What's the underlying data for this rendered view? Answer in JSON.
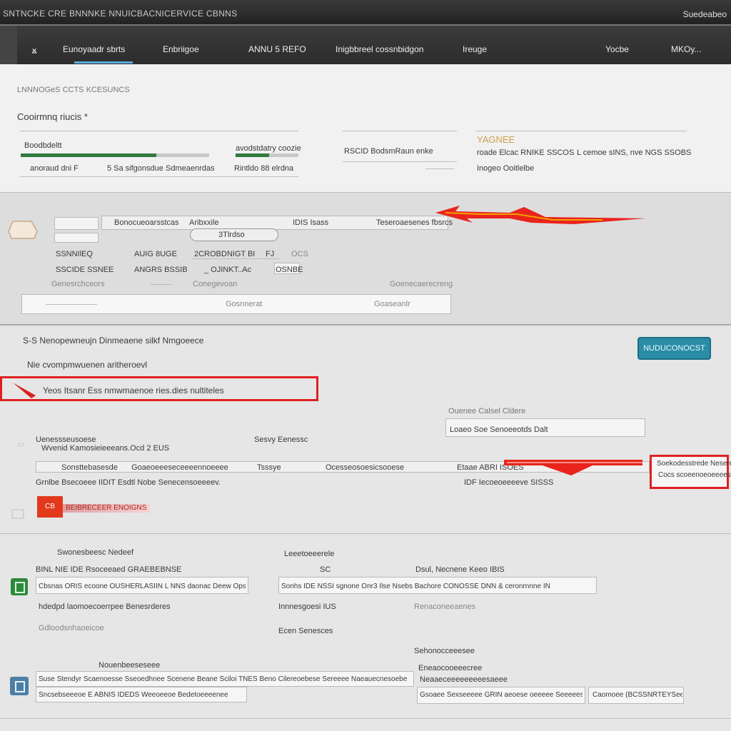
{
  "window": {
    "title": "SNTNCKE CRE BNNNKE NNUICBACNICERVICE CBNNS",
    "right_label": "Suedeabeo"
  },
  "nav": {
    "items": [
      {
        "label": "Eunoyaadr sbrts",
        "active": true
      },
      {
        "label": "Enbriigoe"
      },
      {
        "label": "ANNU 5 REFO"
      },
      {
        "label": "Inigbbreel cossnbidgon"
      },
      {
        "label": "Ireuge"
      },
      {
        "label": "Yocbe"
      },
      {
        "label": "MKOy..."
      }
    ]
  },
  "summary": {
    "breadcrumb": "LNNNOGeS CCTS  KCESUNCS",
    "heading": "Cooirmnq riucis *",
    "card1": {
      "label": "Boodbdeltt",
      "progress_a": 0.22,
      "progress_b": 0.72,
      "foot_left": "anoraud dni F",
      "foot_mid": "5 Sa sifgonsdue",
      "foot_right": "Sdmeaenrdas"
    },
    "card2": {
      "label": "avodstdatry coozie",
      "progress": 0.53,
      "foot": "Rintldo 88 elrdna"
    },
    "card3": {
      "label": "RSCID BodsmRaun enke"
    },
    "card4": {
      "title": "YAGNEE",
      "line1": "roade Elcac RNIKE SSCOS",
      "line2": "L cemoe sINS, nve NGS SSOBS",
      "line3": "Inogeo Ooitlelbe"
    }
  },
  "table": {
    "head_col1": "Bonocueoarsstcas",
    "head_col2": "Aribxxile",
    "head_col3": "IDIS Isass",
    "head_col4": "Teseroaesenes fbsrcs",
    "pill": "3Tlrdso",
    "row1": {
      "c1": "SSNNIlEQ",
      "c2": "AUIG 8UGE",
      "c3": "2CROBDNIGT BI",
      "c4": "FJ",
      "c5": "OCS"
    },
    "row2": {
      "c1": "SSCIDE SSNEE",
      "c2": "ANGRS BSSIB",
      "c3": "_ OJINKT..Ac",
      "c4": "OSNBE"
    },
    "row3": {
      "c1": "Genesrchceors",
      "c2": "Conegevoan",
      "c3": "Goenecaerecreng"
    },
    "row4": {
      "c1": "Gosnnerat",
      "c2": "Goaseanlr"
    }
  },
  "details": {
    "title": "S-S Nenopewneujn Dinmeaene silkf Nmgoeece",
    "subtitle": "Nie cvompmwuenen aritheroevl",
    "highlight": "Yeos Itsanr Ess   nmwmaenoe ries.dies nultiteles",
    "button": "NUDUCONOCST",
    "right_label1": "Ouenee Calsel Cldere",
    "right_label2": "Loaeo Soe Senoeeotds Dalt",
    "left_label1": "Uenessseusoese",
    "left_label2": "Wvenid Kamosieieeeans.Ocd 2 EUS",
    "mid_label": "Sesvy Eenessc",
    "row_cells": [
      "Sonsttebasesde",
      "Goaeoeeeseceeeennoeeee",
      "Tsssye",
      "Ocesseosoesicsooese",
      "Etaae ABRI  ISOES"
    ],
    "redbox_line1": "Soekodesstrede Nesereeo",
    "redbox_line2": "Cocs scoeenoeoeeees Neese",
    "note": "Grnlbe Bsecoeee IIDIT Esdtl Nobe  Senecensoeeeev.",
    "note_right": "IDF  Iecoeoeeeeve  SISSS",
    "badge": "CB",
    "badge_label": "BEIBRECEER ENOIGNS"
  },
  "footer": {
    "a_label": "Swonesbeesc Nedeef",
    "a_line": "BINL  NIE  IDE Rsoceeaed GRAEBEBNSE",
    "a_field": "Cbsnas ORIS  ecoone OUSHERLASIIN  L NNS daonac Deew  Opsuiveoolmuahoeel",
    "a_text": "hdedpd laomoecoerrpee Benesrderes",
    "a_meta": "Gdloodsnhaoeicoe",
    "b_label": "Leeetoeeerele",
    "b_line": "SC",
    "b_field": "Sonhs IDE NSSI sgnone Onr3  Ilse Nsebs  Bachore CONOSSE DNN & ceronrnnne IN",
    "b_text": "Innnesgoesi IUS",
    "b_meta": "Ecen Senesces",
    "c_label": "Dsul, Necnene Keeo IBIS",
    "c_text": "Renaconeeaenes",
    "d_label": "Sehonocceeesee",
    "d_line": "Nouenbeeseseee",
    "d_cap": "Eneaocooeeecree",
    "e_field": "Suse Stendyr Scaenoesse Sseoedhnee Scenene Beane Sciloi TNES Beno Cilereoebese Sereeee Naeauecnesoebe",
    "e_meta": "Neaaeceeeeeeeeesaeee",
    "f_field": "Sncsebseeeoe E  ABNIS IDEDS Weeoeeoe Bedetoeeeenee",
    "f_mid": "Gsoaee Sexseeeee GRIN aeoese oeeeee Seeeees",
    "f_right": "Caomoee (BCSSNRTEYSee.soe"
  }
}
